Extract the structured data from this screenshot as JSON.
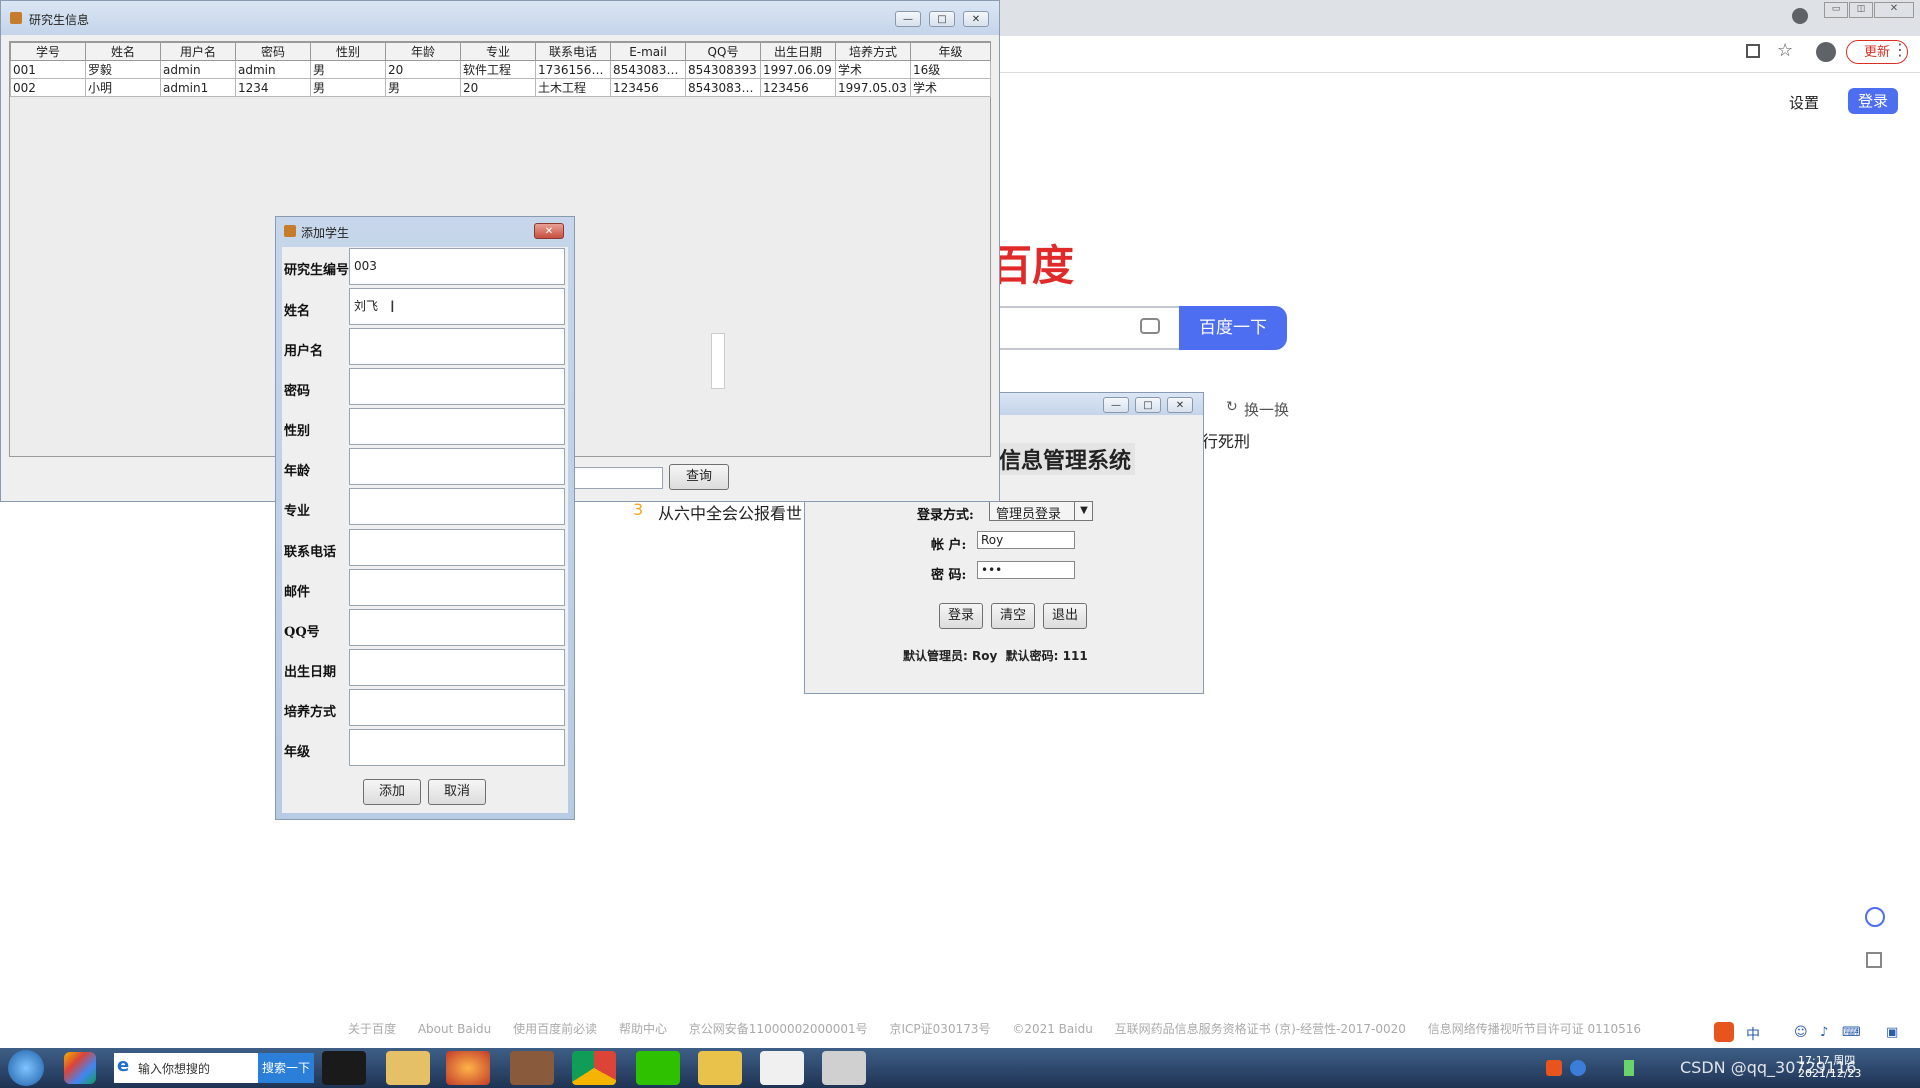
{
  "browser": {
    "update_label": "更新",
    "settings_label": "设置",
    "login_label": "登录",
    "logo_text": "百度",
    "search_button_label": "百度一下",
    "refresh_label": "换一换",
    "hot_item_text": "行死刑",
    "hot_list_number": "3",
    "hot_list_text": "从六中全会公报看世",
    "footer_links": [
      "关于百度",
      "About Baidu",
      "使用百度前必读",
      "帮助中心",
      "京公网安备11000002000001号",
      "京ICP证030173号",
      "©2021 Baidu",
      "互联网药品信息服务资格证书 (京)-经营性-2017-0020",
      "信息网络传播视听节目许可证 0110516"
    ]
  },
  "student_window": {
    "title": "研究生信息",
    "columns": [
      "学号",
      "姓名",
      "用户名",
      "密码",
      "性别",
      "年龄",
      "专业",
      "联系电话",
      "E-mail",
      "QQ号",
      "出生日期",
      "培养方式",
      "年级"
    ],
    "rows": [
      [
        "001",
        "罗毅",
        "admin",
        "admin",
        "男",
        "20",
        "软件工程",
        "173615644...",
        "854308393...",
        "854308393",
        "1997.06.09",
        "学术",
        "16级"
      ],
      [
        "002",
        "小明",
        "admin1",
        "1234",
        "男",
        "男",
        "20",
        "土木工程",
        "123456",
        "854308303...",
        "123456",
        "1997.05.03",
        "学术"
      ]
    ],
    "query_button_label": "查询"
  },
  "add_dialog": {
    "title": "添加学生",
    "fields": [
      {
        "label": "研究生编号",
        "value": "003"
      },
      {
        "label": "姓名",
        "value": "刘飞"
      },
      {
        "label": "用户名",
        "value": ""
      },
      {
        "label": "密码",
        "value": ""
      },
      {
        "label": "性别",
        "value": ""
      },
      {
        "label": "年龄",
        "value": ""
      },
      {
        "label": "专业",
        "value": ""
      },
      {
        "label": "联系电话",
        "value": ""
      },
      {
        "label": "邮件",
        "value": ""
      },
      {
        "label": "QQ号",
        "value": ""
      },
      {
        "label": "出生日期",
        "value": ""
      },
      {
        "label": "培养方式",
        "value": ""
      },
      {
        "label": "年级",
        "value": ""
      }
    ],
    "add_label": "添加",
    "cancel_label": "取消"
  },
  "login_window": {
    "heading": "信息管理系统",
    "login_mode_label": "登录方式:",
    "login_mode_value": "管理员登录",
    "account_label": "帐 户:",
    "account_value": "Roy",
    "password_label": "密 码:",
    "password_value": "•••",
    "login_button": "登录",
    "clear_button": "清空",
    "exit_button": "退出",
    "default_info": "默认管理员: Roy  默认密码: 111"
  },
  "taskbar": {
    "search_placeholder": "输入你想搜的",
    "search_button": "搜索一下",
    "ime_label": "中",
    "clock_time": "17:17 周四",
    "clock_date": "2021/12/23",
    "watermark": "CSDN @qq_30729116"
  }
}
